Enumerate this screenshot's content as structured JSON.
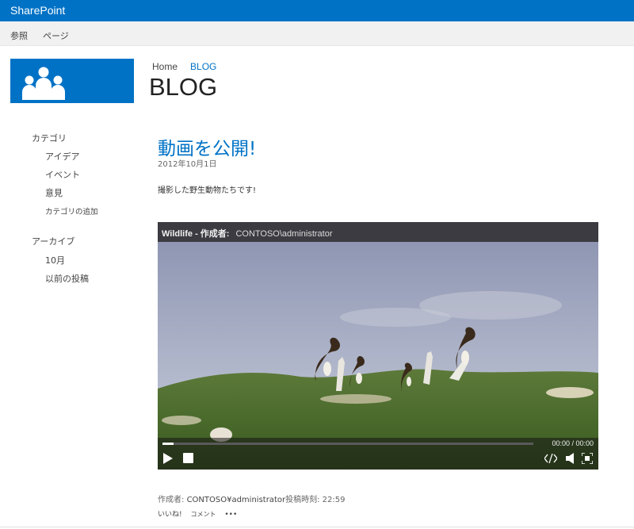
{
  "suitebar": {
    "brand": "SharePoint"
  },
  "ribbon": {
    "tabs": [
      "参照",
      "ページ"
    ]
  },
  "breadcrumb": {
    "home": "Home",
    "current": "BLOG"
  },
  "site": {
    "title": "BLOG"
  },
  "quick_launch": {
    "categories_heading": "カテゴリ",
    "categories": [
      "アイデア",
      "イベント",
      "意見"
    ],
    "add_category": "カテゴリの追加",
    "archive_heading": "アーカイブ",
    "archive": [
      "10月",
      "以前の投稿"
    ]
  },
  "post": {
    "title": "動画を公開!",
    "date": "2012年10月1日",
    "body": "撮影した野生動物たちです!",
    "author_prefix": "作成者: ",
    "author": "CONTOSO¥administrator",
    "posted_label": "投稿時刻: 22:59",
    "like": "いいね!",
    "comment": "コメント",
    "more": "•••"
  },
  "video": {
    "title": "Wildlife - 作成者:",
    "author": "CONTOSO\\administrator",
    "time": "00:00 / 00:00",
    "progress": 0.03
  },
  "colors": {
    "suitebar": "#0072c6",
    "link": "#0072c6",
    "player_titlebar": "#3b3b41"
  },
  "icons": [
    "people-logo-icon",
    "play-icon",
    "stop-icon",
    "embed-icon",
    "volume-icon",
    "fullscreen-icon"
  ]
}
